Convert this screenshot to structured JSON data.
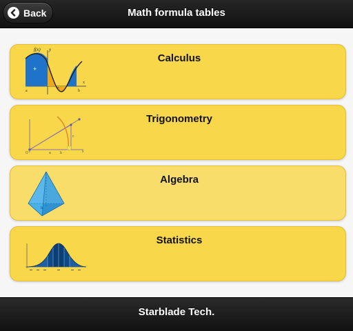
{
  "header": {
    "title": "Math formula tables",
    "back_label": "Back"
  },
  "menu": {
    "items": [
      {
        "label": "Calculus"
      },
      {
        "label": "Trigonometry"
      },
      {
        "label": "Algebra"
      },
      {
        "label": "Statistics"
      }
    ]
  },
  "footer": {
    "text": "Starblade Tech."
  },
  "colors": {
    "card": "#f8d74a",
    "header": "#1b1b1b",
    "accent_blue": "#1e73c8"
  },
  "icons": [
    "chevron-left-icon",
    "calculus-graph-icon",
    "trig-triangle-icon",
    "pyramid-icon",
    "normal-distribution-icon"
  ]
}
